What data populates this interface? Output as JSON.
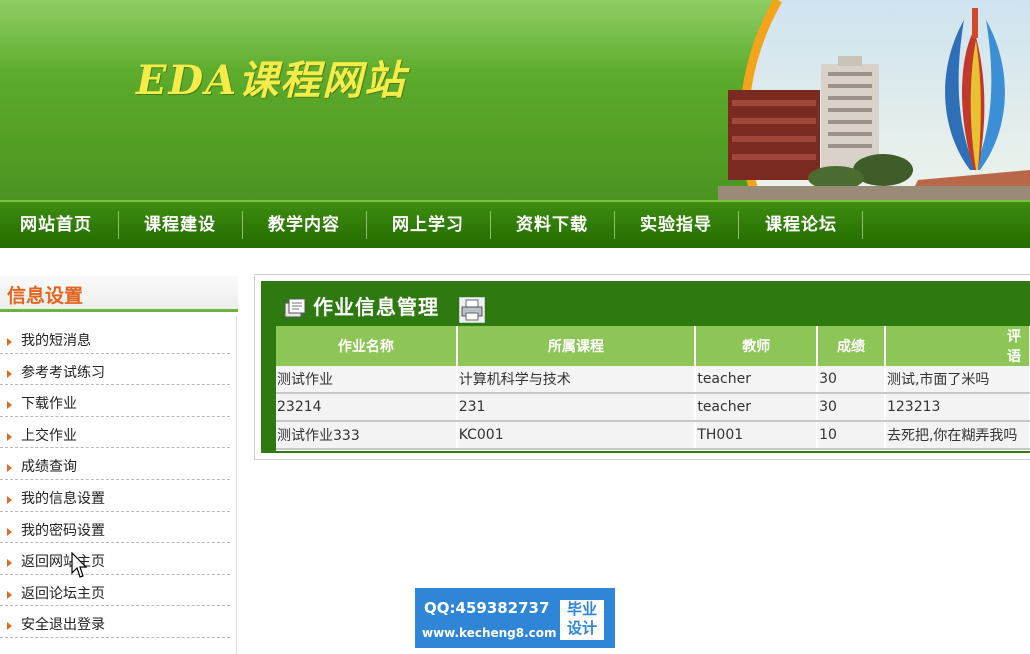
{
  "banner": {
    "title": "EDA课程网站"
  },
  "topnav": {
    "items": [
      "网站首页",
      "课程建设",
      "教学内容",
      "网上学习",
      "资料下载",
      "实验指导",
      "课程论坛"
    ]
  },
  "sidebar": {
    "title": "信息设置",
    "items": [
      "我的短消息",
      "参考考试练习",
      "下载作业",
      "上交作业",
      "成绩查询",
      "我的信息设置",
      "我的密码设置",
      "返回网站主页",
      "返回论坛主页",
      "安全退出登录"
    ]
  },
  "panel": {
    "title": "作业信息管理",
    "columns": [
      "作业名称",
      "所属课程",
      "教师",
      "成绩",
      "评语"
    ],
    "rows": [
      [
        "测试作业",
        "计算机科学与技术",
        "teacher",
        "30",
        "测试,市面了米吗"
      ],
      [
        "23214",
        "231",
        "teacher",
        "30",
        "123213"
      ],
      [
        "测试作业333",
        "KC001",
        "TH001",
        "10",
        "去死把,你在糊弄我吗"
      ]
    ]
  },
  "ad": {
    "qq": "QQ:459382737",
    "url": "www.kecheng8.com",
    "tag_line1": "毕业",
    "tag_line2": "设计"
  },
  "colors": {
    "nav_green": "#2e7a06",
    "header_green": "#8dc556",
    "accent_orange": "#e0661e",
    "ad_blue": "#2f86d6"
  },
  "icons": {
    "menu_bullet": "arrow-right-icon",
    "panel_left": "document-icon",
    "panel_print": "printer-icon"
  }
}
